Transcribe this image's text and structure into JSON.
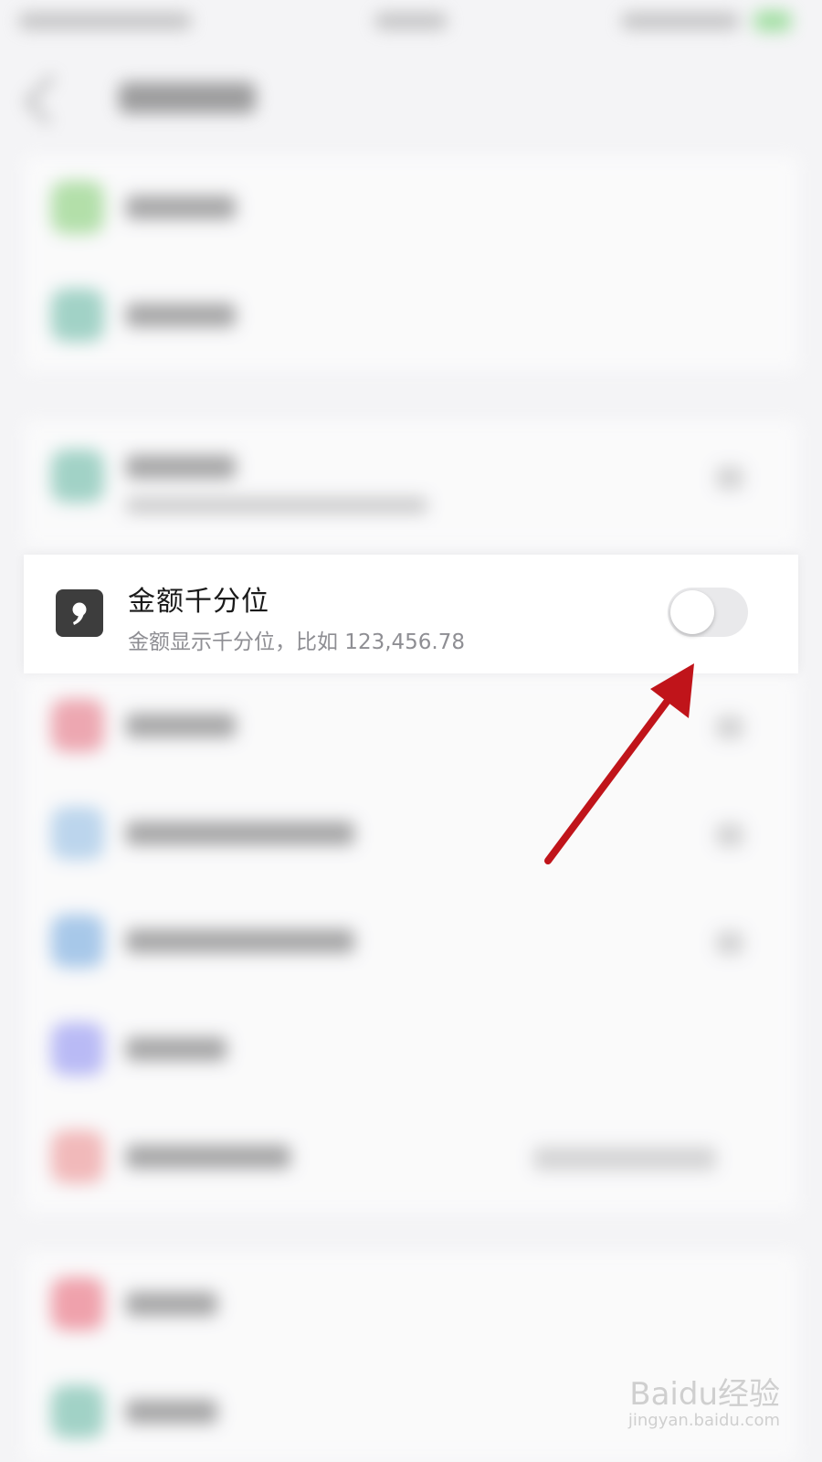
{
  "settings_row": {
    "icon": "comma-icon",
    "title": "金额千分位",
    "subtitle": "金额显示千分位，比如 123,456.78",
    "toggle_state": "off"
  },
  "annotation": {
    "arrow_color": "#c0141a"
  },
  "watermark": {
    "logo": "Baidu经验",
    "url": "jingyan.baidu.com"
  },
  "colors": {
    "background": "#f4f4f6",
    "row_background": "#ffffff",
    "icon_background": "#3d3d3d",
    "toggle_off": "#e9e9eb"
  }
}
